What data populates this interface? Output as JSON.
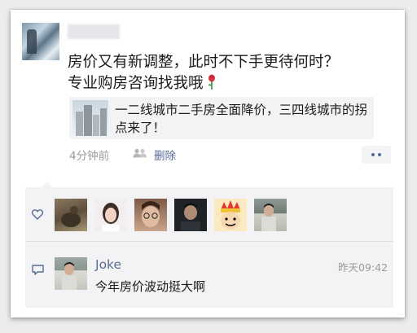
{
  "post": {
    "text_line1": "房价又有新调整，此时不下手更待何时？",
    "text_line2": "专业购房咨询找我哦",
    "link_card": {
      "title": "一二线城市二手房全面降价，三四线城市的拐点来了！"
    },
    "time_ago": "4分钟前",
    "delete_label": "删除"
  },
  "likes": {
    "avatars": [
      {
        "icon": "avatar-sculpture"
      },
      {
        "icon": "avatar-girl"
      },
      {
        "icon": "avatar-woman-glasses"
      },
      {
        "icon": "avatar-man-dark"
      },
      {
        "icon": "avatar-cartoon-king"
      },
      {
        "icon": "avatar-man-street"
      }
    ]
  },
  "comments": [
    {
      "author": "Joke",
      "time": "昨天09:42",
      "text": "今年房价波动挺大啊"
    }
  ],
  "colors": {
    "link_blue": "#576b95",
    "meta_gray": "#9a9a9a",
    "panel_bg": "#f3f3f5"
  }
}
